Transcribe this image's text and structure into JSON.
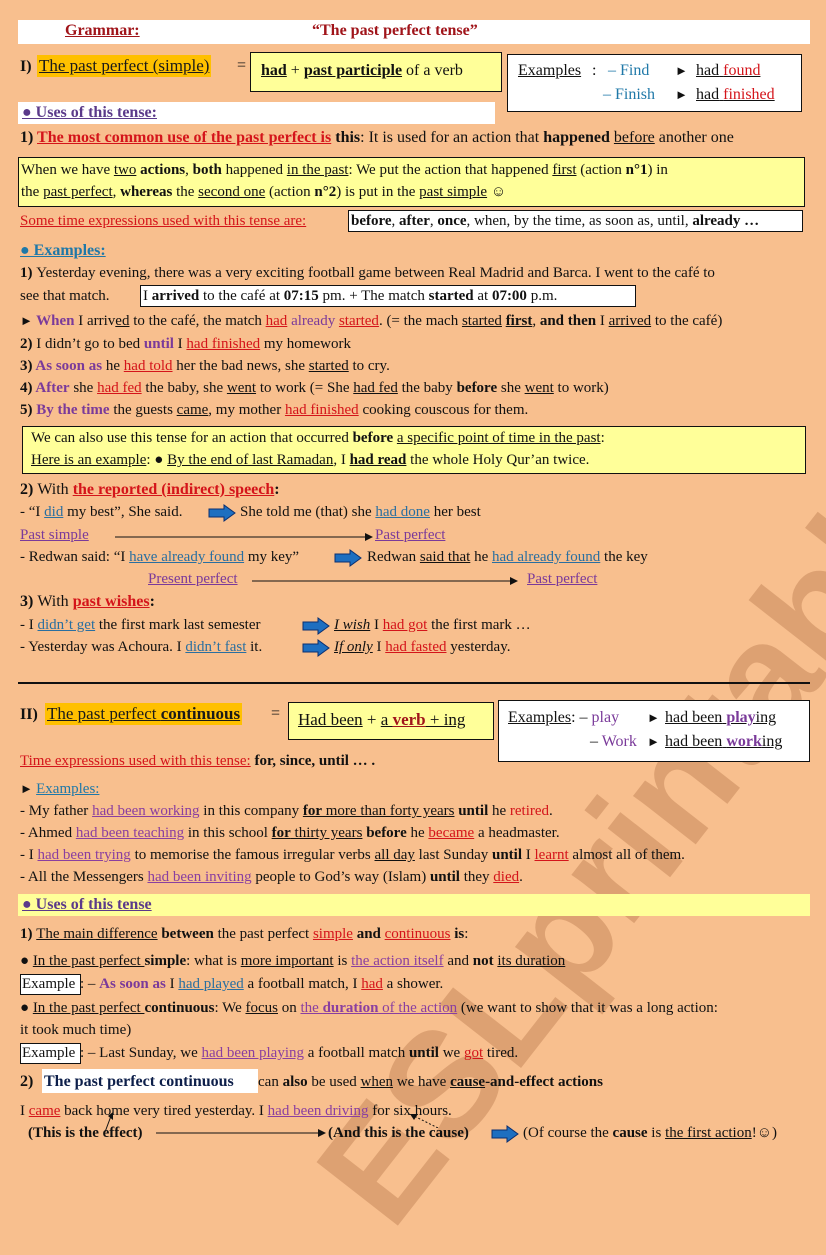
{
  "watermark": "ESLprintables.com",
  "header": {
    "label": "Grammar:",
    "title": "“The past perfect tense”"
  },
  "section1": {
    "heading_num": "I)",
    "heading": "The past perfect (simple)",
    "equals": "=",
    "formula": [
      {
        "t": "had",
        "c": "b u"
      },
      {
        "t": " + "
      },
      {
        "t": "past participle",
        "c": "b u"
      },
      {
        "t": " of a verb"
      }
    ],
    "examples_label": "Examples",
    "examples": [
      {
        "verb": "– Find",
        "arrow": "►",
        "had": "had",
        "pp": "found"
      },
      {
        "verb": "– Finish",
        "arrow": "►",
        "had": "had",
        "pp": "finished"
      }
    ],
    "uses_heading": "● Uses of this tense:",
    "use1": [
      {
        "t": "1) ",
        "c": "b"
      },
      {
        "t": "The most common use of the past perfect is",
        "c": "b u red"
      },
      {
        "t": " this",
        "c": "b"
      },
      {
        "t": ": It is used for an action that "
      },
      {
        "t": "happened",
        "c": "b"
      },
      {
        "t": " "
      },
      {
        "t": "before",
        "c": "u"
      },
      {
        "t": " another one"
      }
    ],
    "rule_box": [
      [
        {
          "t": "When we have "
        },
        {
          "t": "two",
          "c": "u"
        },
        {
          "t": " "
        },
        {
          "t": "actions",
          "c": "b"
        },
        {
          "t": ", "
        },
        {
          "t": "both",
          "c": "b"
        },
        {
          "t": " happened "
        },
        {
          "t": "in the past",
          "c": "u"
        },
        {
          "t": ": We put the action that happened "
        },
        {
          "t": "first",
          "c": "u"
        },
        {
          "t": " (action "
        },
        {
          "t": "n°1",
          "c": "b"
        },
        {
          "t": ") in"
        }
      ],
      [
        {
          "t": "the "
        },
        {
          "t": "past perfect",
          "c": "u"
        },
        {
          "t": ", "
        },
        {
          "t": "whereas",
          "c": "b"
        },
        {
          "t": " the "
        },
        {
          "t": "second one",
          "c": "u"
        },
        {
          "t": " (action "
        },
        {
          "t": "n°2",
          "c": "b"
        },
        {
          "t": ") is put in the "
        },
        {
          "t": "past simple",
          "c": "u"
        },
        {
          "t": " ☺"
        }
      ]
    ],
    "time_expr_label": "Some time expressions used with this tense are:",
    "time_expr": [
      {
        "t": "before",
        "c": "b"
      },
      {
        "t": ", "
      },
      {
        "t": "after",
        "c": "b"
      },
      {
        "t": ", "
      },
      {
        "t": "once",
        "c": "b"
      },
      {
        "t": ", when, by the time, as soon as, until, "
      },
      {
        "t": "already …",
        "c": "b"
      }
    ],
    "examples_heading": "● Examples:",
    "ex1_line1": [
      {
        "t": "1) ",
        "c": "b"
      },
      {
        "t": " Yesterday evening, there was a very exciting football game between Real Madrid and Barca. I went to the café to"
      }
    ],
    "ex1_line2_pre": "see that match.",
    "ex1_box": [
      {
        "t": "I "
      },
      {
        "t": "arrived",
        "c": "b"
      },
      {
        "t": " to the café at "
      },
      {
        "t": "07:15",
        "c": "b"
      },
      {
        "t": " pm.     +     The match "
      },
      {
        "t": "started",
        "c": "b"
      },
      {
        "t": " at "
      },
      {
        "t": "07:00",
        "c": "b"
      },
      {
        "t": " p.m."
      }
    ],
    "ex1_result": [
      {
        "t": "► ",
        "c": "tri"
      },
      {
        "t": "When",
        "c": "b purple"
      },
      {
        "t": " I arriv"
      },
      {
        "t": "ed",
        "c": "u"
      },
      {
        "t": " to the café, the match "
      },
      {
        "t": "had",
        "c": "u red"
      },
      {
        "t": " already ",
        "c": "purple"
      },
      {
        "t": "started",
        "c": "u red"
      },
      {
        "t": ". (= the mach "
      },
      {
        "t": "started",
        "c": "u"
      },
      {
        "t": " "
      },
      {
        "t": "first",
        "c": "b u"
      },
      {
        "t": ", "
      },
      {
        "t": "and then",
        "c": "b"
      },
      {
        "t": " I "
      },
      {
        "t": "arrived",
        "c": "u"
      },
      {
        "t": " to the café)"
      }
    ],
    "ex2": [
      {
        "t": "2) ",
        "c": "b"
      },
      {
        "t": "I didn’t go to bed "
      },
      {
        "t": "until",
        "c": "b purple"
      },
      {
        "t": " I "
      },
      {
        "t": "had finished",
        "c": "u red"
      },
      {
        "t": " my homework"
      }
    ],
    "ex3": [
      {
        "t": "3) ",
        "c": "b"
      },
      {
        "t": "As soon as",
        "c": "b purple"
      },
      {
        "t": " he "
      },
      {
        "t": "had told",
        "c": "u red"
      },
      {
        "t": " her the bad news, she "
      },
      {
        "t": "started",
        "c": "u"
      },
      {
        "t": " to cry."
      }
    ],
    "ex4": [
      {
        "t": "4) ",
        "c": "b"
      },
      {
        "t": "After",
        "c": "b purple"
      },
      {
        "t": " she "
      },
      {
        "t": "had fed",
        "c": "u red"
      },
      {
        "t": " the baby, she "
      },
      {
        "t": "went",
        "c": "u"
      },
      {
        "t": " to work   (= She "
      },
      {
        "t": "had fed",
        "c": "u"
      },
      {
        "t": " the baby "
      },
      {
        "t": "before",
        "c": "b"
      },
      {
        "t": " she "
      },
      {
        "t": "went",
        "c": "u"
      },
      {
        "t": " to work)"
      }
    ],
    "ex5": [
      {
        "t": "5) ",
        "c": "b"
      },
      {
        "t": "By the time",
        "c": "b purple"
      },
      {
        "t": " the guests "
      },
      {
        "t": "came",
        "c": "u"
      },
      {
        "t": ", my mother "
      },
      {
        "t": "had finished",
        "c": "u red"
      },
      {
        "t": " cooking couscous for them."
      }
    ],
    "point_box": [
      [
        {
          "t": "We can also use this tense for an action that occurred "
        },
        {
          "t": "before",
          "c": "b"
        },
        {
          "t": " "
        },
        {
          "t": "a specific point of time in the past",
          "c": "u"
        },
        {
          "t": ":"
        }
      ],
      [
        {
          "t": "Here is an example",
          "c": "u"
        },
        {
          "t": ":  ● "
        },
        {
          "t": "By the end of last Ramadan",
          "c": "u"
        },
        {
          "t": ", I "
        },
        {
          "t": "had read",
          "c": "b u"
        },
        {
          "t": " the whole Holy Qur’an twice."
        }
      ]
    ],
    "reported_heading": [
      {
        "t": "2) ",
        "c": "b"
      },
      {
        "t": "With "
      },
      {
        "t": "the reported (indirect) speech",
        "c": "b u red"
      },
      {
        "t": ":",
        "c": "b"
      }
    ],
    "reported1_a": [
      {
        "t": "- “I "
      },
      {
        "t": "did",
        "c": "u blue"
      },
      {
        "t": " my best”, She said."
      }
    ],
    "reported1_b": [
      {
        "t": "She told me (that) she "
      },
      {
        "t": "had done",
        "c": "u blue"
      },
      {
        "t": " her best"
      }
    ],
    "reported1_from": "Past simple",
    "reported1_to": "Past perfect",
    "reported2_a": [
      {
        "t": "- Redwan said: “I "
      },
      {
        "t": "have already found",
        "c": "u blue"
      },
      {
        "t": " my key”"
      }
    ],
    "reported2_b": [
      {
        "t": "Redwan "
      },
      {
        "t": "said that",
        "c": "u"
      },
      {
        "t": " he "
      },
      {
        "t": "had already found",
        "c": "u blue"
      },
      {
        "t": " the key"
      }
    ],
    "reported2_from": "Present perfect",
    "reported2_to": "Past perfect",
    "wishes_heading": [
      {
        "t": "3) ",
        "c": "b"
      },
      {
        "t": "With "
      },
      {
        "t": "past wishes",
        "c": "b u red"
      },
      {
        "t": ":",
        "c": "b"
      }
    ],
    "wish1_a": [
      {
        "t": "- I "
      },
      {
        "t": "didn’t get",
        "c": "u blue"
      },
      {
        "t": " the first mark last semester"
      }
    ],
    "wish1_b": [
      {
        "t": "I wish",
        "c": "i u"
      },
      {
        "t": " I "
      },
      {
        "t": "had got",
        "c": "u red"
      },
      {
        "t": " the first mark …"
      }
    ],
    "wish2_a": [
      {
        "t": "- Yesterday was Achoura. I "
      },
      {
        "t": "didn’t fast",
        "c": "u blue"
      },
      {
        "t": " it."
      }
    ],
    "wish2_b": [
      {
        "t": "If only",
        "c": "i u"
      },
      {
        "t": " I "
      },
      {
        "t": "had fasted",
        "c": "u red"
      },
      {
        "t": " yesterday."
      }
    ]
  },
  "section2": {
    "heading_num": "II)",
    "heading_a": "The past perfect ",
    "heading_b": "continuous",
    "equals": "=",
    "formula": [
      {
        "t": "Had been",
        "c": "u"
      },
      {
        "t": " + "
      },
      {
        "t": "a ",
        "c": "u"
      },
      {
        "t": "verb",
        "c": "u b dred"
      },
      {
        "t": " + ing",
        "c": "u"
      }
    ],
    "examples_label": "Examples",
    "examples": [
      {
        "dash": "– ",
        "verb": "play",
        "arrow": "►",
        "had": "had been",
        "stem": "play",
        "suffix": "ing"
      },
      {
        "dash": "– ",
        "verb": "Work",
        "arrow": "►",
        "had": "had been",
        "stem": "work",
        "suffix": "ing"
      }
    ],
    "time_expr_label": "Time expressions used with this tense:",
    "time_expr": " for, since, until … .",
    "examples_heading": "Examples:",
    "ex1": [
      {
        "t": "- My father "
      },
      {
        "t": "had been working",
        "c": "u lpurple"
      },
      {
        "t": " in this company "
      },
      {
        "t": "for",
        "c": "b u"
      },
      {
        "t": " more than forty years",
        "c": "u"
      },
      {
        "t": " "
      },
      {
        "t": "until",
        "c": "b"
      },
      {
        "t": " he "
      },
      {
        "t": "retired",
        "c": "red"
      },
      {
        "t": "."
      }
    ],
    "ex2": [
      {
        "t": "- Ahmed "
      },
      {
        "t": "had been teaching",
        "c": "u lpurple"
      },
      {
        "t": " in this school "
      },
      {
        "t": "for",
        "c": "b u"
      },
      {
        "t": " thirty years",
        "c": "u"
      },
      {
        "t": " "
      },
      {
        "t": "before",
        "c": "b"
      },
      {
        "t": " he "
      },
      {
        "t": "became",
        "c": "u red"
      },
      {
        "t": " a headmaster."
      }
    ],
    "ex3": [
      {
        "t": "- I "
      },
      {
        "t": "had been trying",
        "c": "u lpurple"
      },
      {
        "t": " to memorise the famous irregular verbs "
      },
      {
        "t": "all day",
        "c": "u"
      },
      {
        "t": " last Sunday "
      },
      {
        "t": "until",
        "c": "b"
      },
      {
        "t": " I "
      },
      {
        "t": "learnt",
        "c": "u red"
      },
      {
        "t": " almost all of them."
      }
    ],
    "ex4": [
      {
        "t": "- All the Messengers "
      },
      {
        "t": "had been inviting",
        "c": "u lpurple"
      },
      {
        "t": " people to God’s way (Islam) "
      },
      {
        "t": "until",
        "c": "b"
      },
      {
        "t": " they "
      },
      {
        "t": "died",
        "c": "u red"
      },
      {
        "t": "."
      }
    ],
    "uses_heading": "● Uses of this tense",
    "diff": [
      {
        "t": "1) ",
        "c": "b"
      },
      {
        "t": "The main difference",
        "c": "u"
      },
      {
        "t": " "
      },
      {
        "t": "between",
        "c": "b"
      },
      {
        "t": " the past perfect "
      },
      {
        "t": "simple",
        "c": "u red"
      },
      {
        "t": " "
      },
      {
        "t": "and",
        "c": "b"
      },
      {
        "t": " "
      },
      {
        "t": "continuous",
        "c": "u red"
      },
      {
        "t": " "
      },
      {
        "t": "is",
        "c": "b"
      },
      {
        "t": ":"
      }
    ],
    "simple_point": [
      {
        "t": "●  "
      },
      {
        "t": "In the past perfect ",
        "c": "u"
      },
      {
        "t": "simple",
        "c": "b"
      },
      {
        "t": ":  what is "
      },
      {
        "t": "more important",
        "c": "u"
      },
      {
        "t": " is "
      },
      {
        "t": "the action itself",
        "c": "u lpurple"
      },
      {
        "t": " and "
      },
      {
        "t": "not",
        "c": "b"
      },
      {
        "t": " "
      },
      {
        "t": "its duration",
        "c": "u"
      }
    ],
    "example_label": "Example",
    "simple_example": [
      {
        "t": ":  – "
      },
      {
        "t": "As soon as",
        "c": "b purple"
      },
      {
        "t": " I "
      },
      {
        "t": "had played",
        "c": "u blue"
      },
      {
        "t": " a football match, I "
      },
      {
        "t": "had",
        "c": "u red"
      },
      {
        "t": " a shower."
      }
    ],
    "cont_point_1": [
      {
        "t": "●  "
      },
      {
        "t": "In the past perfect ",
        "c": "u"
      },
      {
        "t": "continuous",
        "c": "b"
      },
      {
        "t": ":  We "
      },
      {
        "t": "focus",
        "c": "u"
      },
      {
        "t": " on "
      },
      {
        "t": "the ",
        "c": "u lpurple"
      },
      {
        "t": "duration",
        "c": "u b lpurple"
      },
      {
        "t": " of the action",
        "c": "u lpurple"
      },
      {
        "t": " (we want to show that it was a long action:"
      }
    ],
    "cont_point_2": "it took much time)",
    "cont_example": [
      {
        "t": ":   – Last Sunday, we "
      },
      {
        "t": "had been playing",
        "c": "u lpurple"
      },
      {
        "t": " a football match "
      },
      {
        "t": "until",
        "c": "b"
      },
      {
        "t": " we "
      },
      {
        "t": "got",
        "c": "u red"
      },
      {
        "t": " tired."
      }
    ],
    "cause_num": "2)",
    "cause_highlight": "The past perfect continuous",
    "cause_rest": [
      {
        "t": " can "
      },
      {
        "t": "also",
        "c": "b"
      },
      {
        "t": " be used "
      },
      {
        "t": "when",
        "c": "u"
      },
      {
        "t": " we have "
      },
      {
        "t": "cause",
        "c": "b u"
      },
      {
        "t": "-and-effect actions",
        "c": "b"
      }
    ],
    "cause_sentence": [
      {
        "t": "I "
      },
      {
        "t": "came",
        "c": "u red"
      },
      {
        "t": " back home very tired yesterday. I "
      },
      {
        "t": "had been driving",
        "c": "u lpurple"
      },
      {
        "t": " for six hours."
      }
    ],
    "effect_label": "(This is the effect)",
    "cause_label": "(And this is the cause)",
    "conclusion": [
      {
        "t": "(Of course the "
      },
      {
        "t": "cause",
        "c": "b"
      },
      {
        "t": " is "
      },
      {
        "t": "the first action",
        "c": "u"
      },
      {
        "t": "!☺)"
      }
    ]
  }
}
